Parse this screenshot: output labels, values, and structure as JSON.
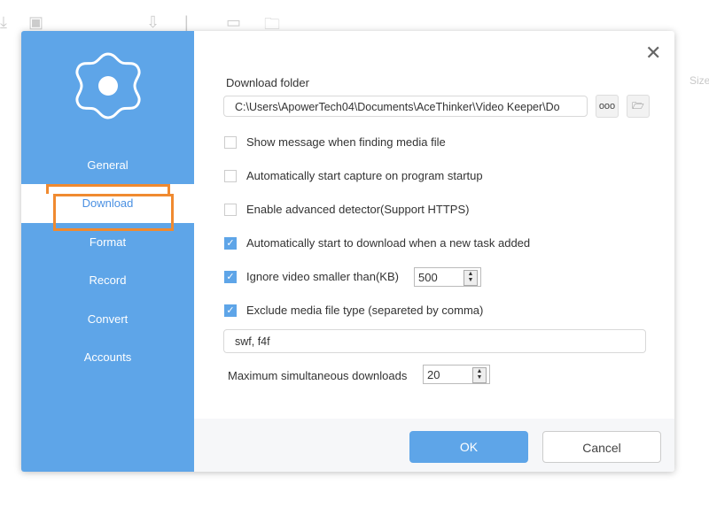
{
  "background": {
    "size_header": "Size"
  },
  "sidebar": {
    "items": [
      {
        "label": "General"
      },
      {
        "label": "Download",
        "selected": true
      },
      {
        "label": "Format"
      },
      {
        "label": "Record"
      },
      {
        "label": "Convert"
      },
      {
        "label": "Accounts"
      }
    ]
  },
  "main": {
    "download_folder_label": "Download folder",
    "download_folder_value": "C:\\Users\\ApowerTech04\\Documents\\AceThinker\\Video Keeper\\Do",
    "more_button": "ooo",
    "options": [
      {
        "label": "Show message when finding media file",
        "checked": false
      },
      {
        "label": "Automatically start capture on program startup",
        "checked": false
      },
      {
        "label": "Enable advanced detector(Support HTTPS)",
        "checked": false
      },
      {
        "label": "Automatically start to download when a new task added",
        "checked": true
      },
      {
        "label": "Ignore video smaller than(KB)",
        "checked": true
      },
      {
        "label": "Exclude media file type (separeted by comma)",
        "checked": true
      }
    ],
    "min_size_value": "500",
    "exclude_types_value": "swf, f4f",
    "max_downloads_label": "Maximum simultaneous downloads",
    "max_downloads_value": "20"
  },
  "footer": {
    "ok": "OK",
    "cancel": "Cancel"
  },
  "colors": {
    "accent": "#5ea5e8",
    "highlight": "#f08a30"
  }
}
